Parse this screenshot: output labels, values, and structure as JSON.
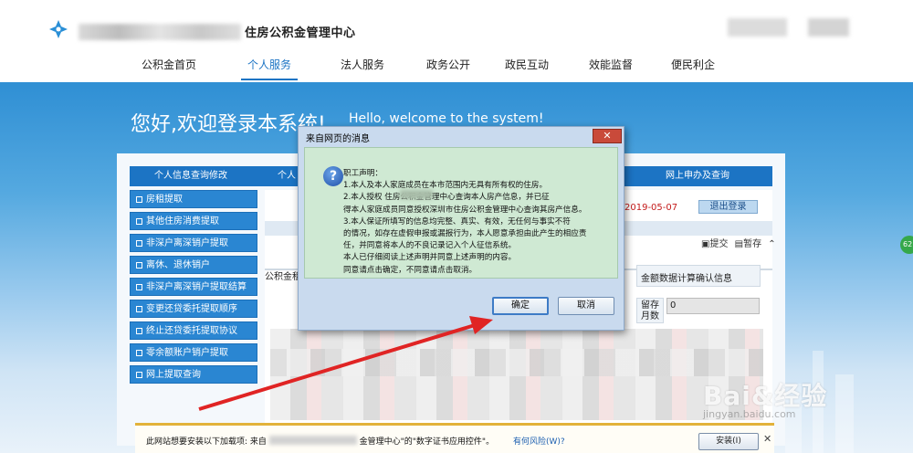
{
  "header": {
    "site_title": "住房公积金管理中心",
    "nav": [
      "公积金首页",
      "个人服务",
      "法人服务",
      "政务公开",
      "政民互动",
      "效能监督",
      "便民利企"
    ],
    "active_nav": "个人服务"
  },
  "banner": {
    "welcome": "您好,欢迎登录本系统!",
    "welcome_en": "Hello, welcome to the system!"
  },
  "panel": {
    "tabs": [
      "个人信息查询修改",
      "个人",
      "网上申办及查询"
    ],
    "menu": [
      "房租提取",
      "其他住房消费提取",
      "非深户离深销户提取",
      "离休、退休销户",
      "非深户离深销户提取结算",
      "变更还贷委托提取顺序",
      "终止还贷委托提取协议",
      "零余额账户销户提取",
      "网上提取查询"
    ],
    "date": "2019-05-07",
    "logout": "退出登录",
    "toolbar_submit": "提交",
    "toolbar_save": "暂存",
    "right_header": "金额数据计算确认信息",
    "left_fragment": "公积金租",
    "remain_label": "留存月数",
    "remain_value": "0"
  },
  "dialog": {
    "title": "来自网页的消息",
    "lines": [
      "职工声明：",
      "    1.本人及本人家庭成员在本市范围内无具有所有权的住房。",
      "    2.本人授权          住房公积金管理中心查询本人房产信息，并已征",
      "得本人家庭成员同意授权深圳市住房公积金管理中心查询其房产信息。",
      "    3.本人保证所填写的信息均完整、真实、有效，无任何与事实不符",
      "的情况，如存在虚假申报或漏报行为，本人愿意承担由此产生的相应责",
      "任，并同意将本人的不良记录记入个人征信系统。",
      "    本人已仔细阅读上述声明并同意上述声明的内容。",
      "    同意请点击确定，不同意请点击取消。"
    ],
    "ok": "确定",
    "cancel": "取消"
  },
  "infobar": {
    "text_prefix": "此网站想要安装以下加载项: 来自",
    "text_suffix": "金管理中心\"的\"数字证书应用控件\"。",
    "link": "有何风险(W)?",
    "install": "安装(I)"
  },
  "edge_badge": "62",
  "watermark": {
    "brand": "Bai&经验",
    "url": "jingyan.baidu.com"
  },
  "colors": {
    "brand_blue": "#1c74c4",
    "dialog_bg": "#cfe9d3",
    "arrow": "#e02424",
    "date_red": "#c41a1a"
  }
}
